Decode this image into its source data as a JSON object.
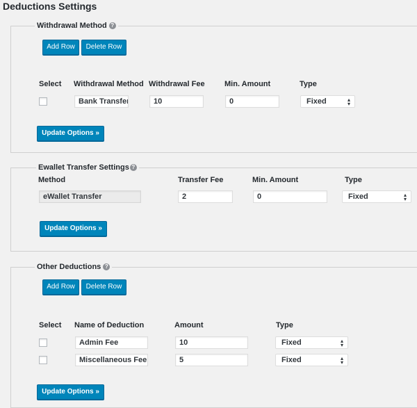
{
  "page": {
    "title": "Deductions Settings"
  },
  "withdrawal": {
    "legend": "Withdrawal Method",
    "add_row": "Add Row",
    "delete_row": "Delete Row",
    "headers": {
      "select": "Select",
      "method": "Withdrawal Method",
      "fee": "Withdrawal Fee",
      "min": "Min. Amount",
      "type": "Type"
    },
    "rows": [
      {
        "method": "Bank Transfer",
        "fee": "10",
        "min": "0",
        "type": "Fixed"
      }
    ],
    "update": "Update Options »"
  },
  "ewallet": {
    "legend": "Ewallet Transfer Settings",
    "headers": {
      "method": "Method",
      "fee": "Transfer Fee",
      "min": "Min. Amount",
      "type": "Type"
    },
    "row": {
      "method": "eWallet Transfer",
      "fee": "2",
      "min": "0",
      "type": "Fixed"
    },
    "update": "Update Options »"
  },
  "other": {
    "legend": "Other Deductions",
    "add_row": "Add Row",
    "delete_row": "Delete Row",
    "headers": {
      "select": "Select",
      "name": "Name of Deduction",
      "amount": "Amount",
      "type": "Type"
    },
    "rows": [
      {
        "name": "Admin Fee",
        "amount": "10",
        "type": "Fixed"
      },
      {
        "name": "Miscellaneous Fee",
        "amount": "5",
        "type": "Fixed"
      }
    ],
    "update": "Update Options »"
  },
  "colors": {
    "primary_button": "#0085ba",
    "background": "#f1f1f1",
    "border": "#cfcfcf"
  },
  "icons": {
    "help": "help-icon",
    "select_arrow": "select-arrow-icon"
  }
}
